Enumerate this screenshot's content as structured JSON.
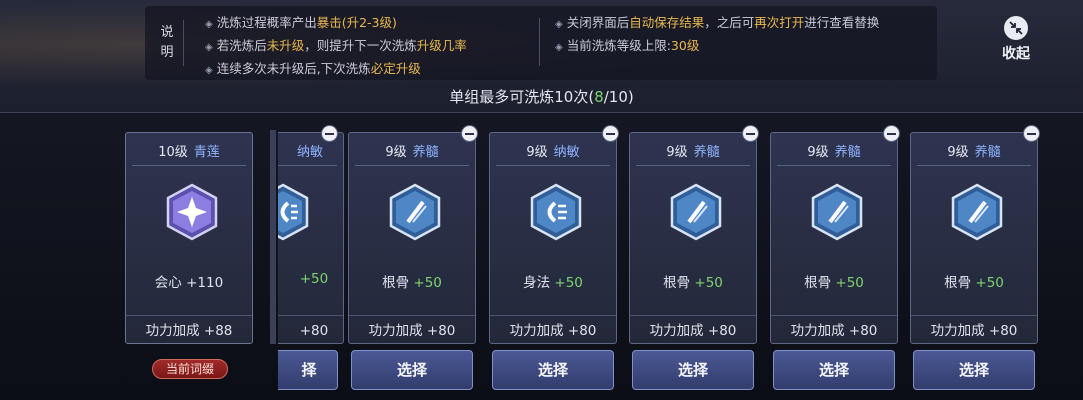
{
  "info": {
    "title_chars": [
      "说",
      "明"
    ],
    "left_lines": [
      {
        "pre": "洗炼过程概率产出",
        "hl": "暴击(升2-3级)",
        "post": ""
      },
      {
        "pre": "若洗炼后",
        "hl": "未升级",
        "post": "，则提升下一次洗炼",
        "hl2": "升级几率"
      },
      {
        "pre": "连续多次未升级后,下次洗炼",
        "hl": "必定升级",
        "post": ""
      }
    ],
    "right_lines": [
      {
        "pre": "关闭界面后",
        "hl": "自动保存结果",
        "post": "，之后可",
        "hl2": "再次打开",
        "post2": "进行查看替换"
      },
      {
        "pre": "当前洗炼等级上限:",
        "hl": "30级",
        "post": ""
      }
    ]
  },
  "collapse": {
    "label": "收起",
    "icon": "shrink-arrows-icon"
  },
  "limit": {
    "text": "单组最多可洗炼10次(",
    "count": "8",
    "rest": "/10)"
  },
  "current": {
    "level": "10级",
    "quality": "青莲",
    "stat_name": "会心",
    "stat_value": "+110",
    "bonus_label": "功力加成",
    "bonus_value": "+88",
    "tag": "当前词缀",
    "gem_icon": "crit-star-gem-icon"
  },
  "partial": {
    "quality": "纳敏",
    "stat_value": "+50",
    "bonus_value": "+80",
    "button": "择"
  },
  "options": [
    {
      "level": "9级",
      "quality": "养髓",
      "stat_name": "根骨",
      "stat_value": "+50",
      "bonus_label": "功力加成",
      "bonus_value": "+80",
      "button": "选择",
      "gem_icon": "bone-gem-icon"
    },
    {
      "level": "9级",
      "quality": "纳敏",
      "stat_name": "身法",
      "stat_value": "+50",
      "bonus_label": "功力加成",
      "bonus_value": "+80",
      "button": "选择",
      "gem_icon": "agility-gem-icon"
    },
    {
      "level": "9级",
      "quality": "养髓",
      "stat_name": "根骨",
      "stat_value": "+50",
      "bonus_label": "功力加成",
      "bonus_value": "+80",
      "button": "选择",
      "gem_icon": "bone-gem-icon"
    },
    {
      "level": "9级",
      "quality": "养髓",
      "stat_name": "根骨",
      "stat_value": "+50",
      "bonus_label": "功力加成",
      "bonus_value": "+80",
      "button": "选择",
      "gem_icon": "bone-gem-icon"
    },
    {
      "level": "9级",
      "quality": "养髓",
      "stat_name": "根骨",
      "stat_value": "+50",
      "bonus_label": "功力加成",
      "bonus_value": "+80",
      "button": "选择",
      "gem_icon": "bone-gem-icon"
    }
  ],
  "colors": {
    "highlight": "#e9b94d",
    "green": "#7fd36e",
    "quality": "#8fb4ff"
  }
}
